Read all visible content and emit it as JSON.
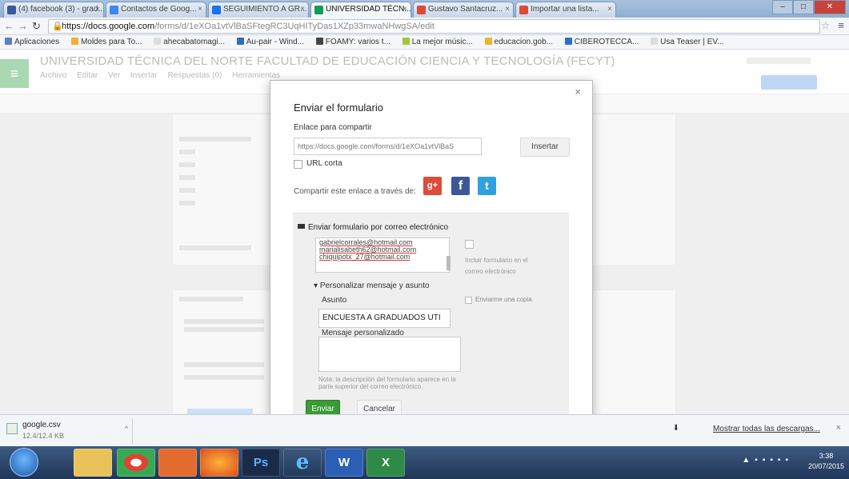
{
  "browser": {
    "tabs": [
      {
        "label": "(4) facebook (3) - grad...",
        "color": "#3b5998",
        "active": false
      },
      {
        "label": "Contactos de Goog...",
        "color": "#4285f4",
        "active": false
      },
      {
        "label": "SEGUIMIENTO A GR...",
        "color": "#1a73e8",
        "active": false
      },
      {
        "label": "UNIVERSIDAD TÉCN...",
        "color": "#0f9d58",
        "active": true
      },
      {
        "label": "Gustavo Santacruz...",
        "color": "#dd4b39",
        "active": false
      },
      {
        "label": "Importar una lista...",
        "color": "#dd4b39",
        "active": false
      }
    ],
    "window_controls": {
      "minimize": "–",
      "maximize": "□",
      "close": "✕"
    },
    "url_host": "https://docs.google.com",
    "url_path": "/forms/d/1eXOa1vtVlBaSFtegRC3UqHITyDas1XZp33mwaNHwgSA/edit",
    "bookmarks": [
      {
        "label": "Aplicaciones",
        "color": "#5c7ec5"
      },
      {
        "label": "Moldes para To...",
        "color": "#f2b134"
      },
      {
        "label": "ahecabatomagi...",
        "color": "#dddddd"
      },
      {
        "label": "Au-pair - Wind...",
        "color": "#2f6fb4"
      },
      {
        "label": "FOAMY: varios t...",
        "color": "#444444"
      },
      {
        "label": "La mejor músic...",
        "color": "#a2c53a"
      },
      {
        "label": "educacion.gob...",
        "color": "#e9b72a"
      },
      {
        "label": "CIBEROTECCA...",
        "color": "#2e6dd0"
      },
      {
        "label": "Usa Teaser | EV...",
        "color": "#dddddd"
      }
    ]
  },
  "forms": {
    "title": "UNIVERSIDAD TÉCNICA DEL NORTE FACULTAD DE EDUCACIÓN CIENCIA Y TECNOLOGÍA (FECYT)",
    "menus": [
      "Archivo",
      "Editar",
      "Ver",
      "Insertar",
      "Respuestas (0)",
      "Herramientas"
    ]
  },
  "dialog": {
    "title": "Enviar el formulario",
    "close": "×",
    "link_label": "Enlace para compartir",
    "link_value": "https://docs.google.com/forms/d/1eXOa1vtVlBaS",
    "insert_button": "Insertar",
    "short_url_label": "URL corta",
    "share_label": "Compartir este enlace a través de:",
    "social": {
      "gplus": "g+",
      "facebook": "f",
      "twitter": "t"
    },
    "email": {
      "heading": "Enviar formulario por correo electrónico",
      "recipients": [
        "gabrielcorrales@hotmail.com",
        "marialisabeth62@hotmail.com",
        "chiquipotx_27@hotmail.com"
      ],
      "include_form_label": "Incluir formulario en el correo electrónico",
      "personalize_label": "Personalizar mensaje y asunto",
      "subject_label": "Asunto",
      "subject_value": "ENCUESTA A GRADUADOS UTI",
      "message_label": "Mensaje personalizado",
      "send_copy_label": "Enviarme una copia",
      "note": "Nota: la descripción del formulario aparece en la parte superior del correo electrónico.",
      "send_button": "Enviar",
      "cancel_button": "Cancelar"
    }
  },
  "downloads": {
    "file_name": "google.csv",
    "file_size": "12.4/12.4 KB",
    "show_all": "Mostrar todas las descargas...",
    "close": "×"
  },
  "taskbar": {
    "clock_time": "3:38",
    "clock_date": "20/07/2015"
  }
}
